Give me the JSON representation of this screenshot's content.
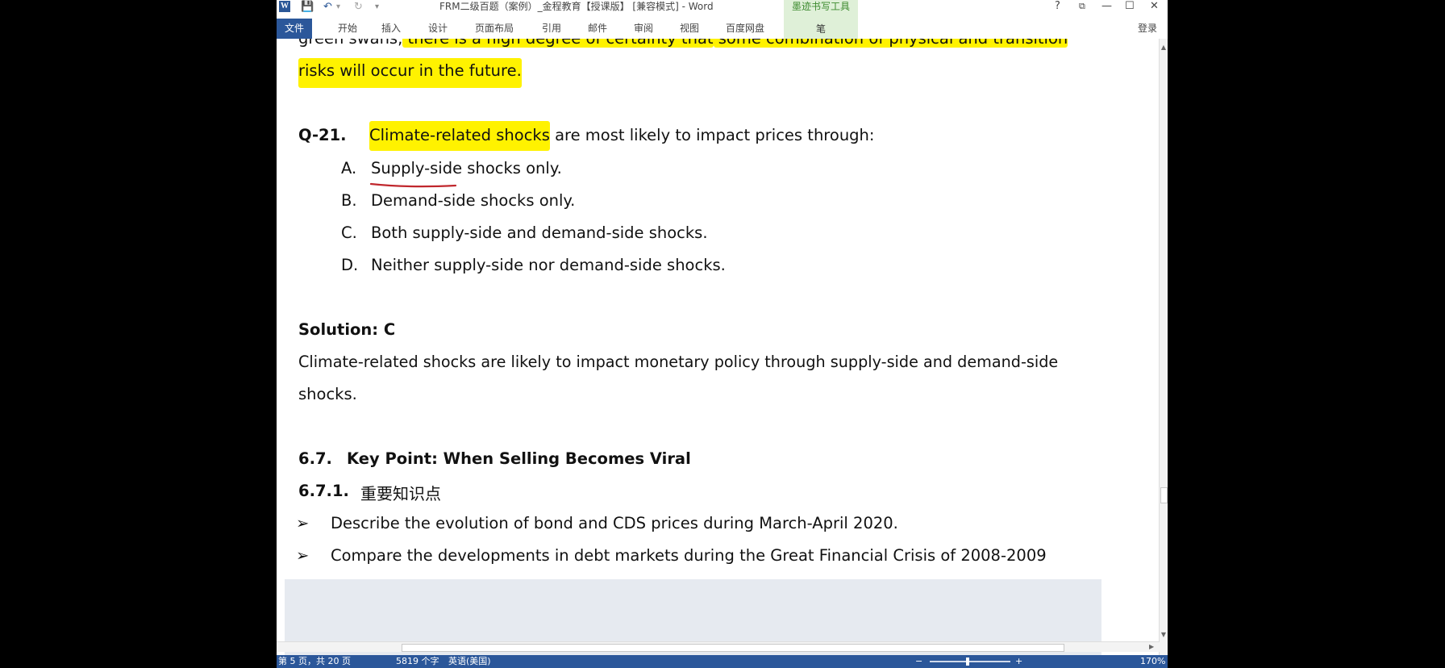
{
  "window": {
    "title": "FRM二级百题（案例）_金程教育【授课版】 [兼容模式] - Word",
    "contextual_group": "墨迹书写工具",
    "contextual_tab": "笔",
    "controls": {
      "help": "?",
      "restore_ribbon": "⧉",
      "minimize": "—",
      "maximize": "☐",
      "close": "✕"
    }
  },
  "quick_access": {
    "app_icon": "W",
    "save": "💾",
    "undo": "↶",
    "redo": "↻",
    "customize": "▾"
  },
  "ribbon": {
    "file": "文件",
    "tabs": [
      "开始",
      "插入",
      "设计",
      "页面布局",
      "引用",
      "邮件",
      "审阅",
      "视图",
      "百度网盘"
    ],
    "login": "登录"
  },
  "document": {
    "prev_line_1_a": "green swans,",
    "prev_line_1_b": " there is a high degree of certainty that",
    "prev_line_1_c": " some combination of physical and transition",
    "prev_line_2": "risks will occur in the future.",
    "question": {
      "number": "Q-21.",
      "stem_highlight": "Climate-related shocks",
      "stem_rest": " are most likely to impact prices through:",
      "options": [
        {
          "letter": "A.",
          "text": "Supply-side shocks only."
        },
        {
          "letter": "B.",
          "text": "Demand-side shocks only."
        },
        {
          "letter": "C.",
          "text": "Both supply-side and demand-side shocks."
        },
        {
          "letter": "D.",
          "text": "Neither supply-side nor demand-side shocks."
        }
      ]
    },
    "solution_title": "Solution: C",
    "solution_line_1": "Climate-related shocks are likely to impact monetary policy through supply-side and demand-side",
    "solution_line_2": "shocks.",
    "section_num": "6.7.",
    "section_title": "Key Point: When Selling Becomes Viral",
    "subsection_num": "6.7.1.",
    "subsection_title": "重要知识点",
    "bullet_symbol": "➢",
    "bullets": [
      "Describe the evolution of bond and CDS prices during March-April 2020.",
      "Compare the developments in debt markets during the Great Financial Crisis of 2008-2009"
    ],
    "highlight_color": "#fff200",
    "ink_color": "#c0272d"
  },
  "statusbar": {
    "page": "第 5 页，共 20 页",
    "words": "5819 个字",
    "language": "英语(美国)",
    "zoom_minus": "−",
    "zoom_plus": "+",
    "zoom": "170%"
  }
}
